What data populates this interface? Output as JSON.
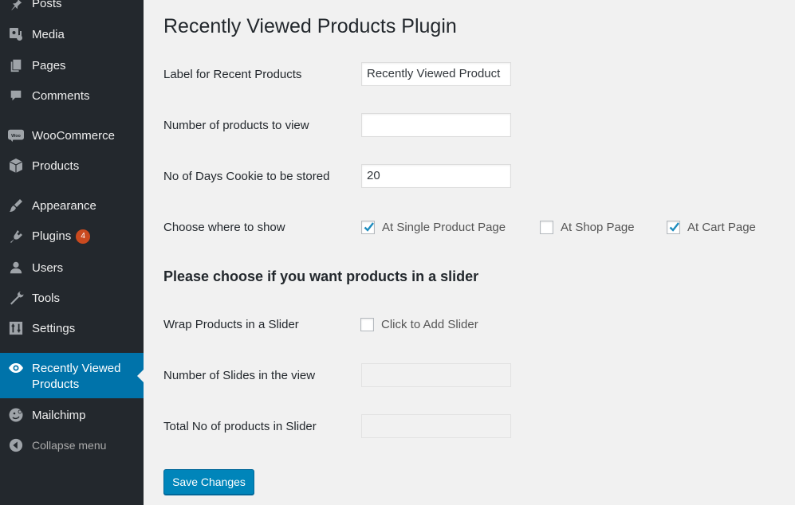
{
  "sidebar": {
    "items": [
      {
        "label": "Posts",
        "icon": "pin-icon"
      },
      {
        "label": "Media",
        "icon": "media-icon"
      },
      {
        "label": "Pages",
        "icon": "pages-icon"
      },
      {
        "label": "Comments",
        "icon": "comments-icon"
      },
      {
        "label": "WooCommerce",
        "icon": "woocommerce-icon"
      },
      {
        "label": "Products",
        "icon": "products-icon"
      },
      {
        "label": "Appearance",
        "icon": "appearance-icon"
      },
      {
        "label": "Plugins",
        "icon": "plugins-icon",
        "badge": "4"
      },
      {
        "label": "Users",
        "icon": "users-icon"
      },
      {
        "label": "Tools",
        "icon": "tools-icon"
      },
      {
        "label": "Settings",
        "icon": "settings-icon"
      },
      {
        "label_line1": "Recently Viewed",
        "label_line2": "Products",
        "icon": "eye-icon",
        "current": true
      },
      {
        "label": "Mailchimp",
        "icon": "mailchimp-icon"
      },
      {
        "label": "Collapse menu",
        "icon": "collapse-icon"
      }
    ],
    "active_color": "#0073aa",
    "background": "#23282d"
  },
  "main": {
    "title": "Recently Viewed Products Plugin",
    "fields": {
      "label_recent": {
        "label": "Label for Recent Products",
        "value": "Recently Viewed Product"
      },
      "num_products": {
        "label": "Number of products to view",
        "value": ""
      },
      "cookie_days": {
        "label": "No of Days Cookie to be stored",
        "value": "20"
      },
      "where_show": {
        "label": "Choose where to show",
        "options": [
          {
            "label": "At Single Product Page",
            "checked": true
          },
          {
            "label": "At Shop Page",
            "checked": false
          },
          {
            "label": "At Cart Page",
            "checked": true
          }
        ]
      }
    },
    "slider_heading": "Please choose if you want products in a slider",
    "slider_fields": {
      "wrap": {
        "label": "Wrap Products in a Slider",
        "option_label": "Click to Add Slider",
        "checked": false
      },
      "slides_in_view": {
        "label": "Number of Slides in the view",
        "value": ""
      },
      "total_in_slider": {
        "label": "Total No of products in Slider",
        "value": ""
      }
    },
    "save_label": "Save Changes",
    "button_color": "#0085ba"
  }
}
